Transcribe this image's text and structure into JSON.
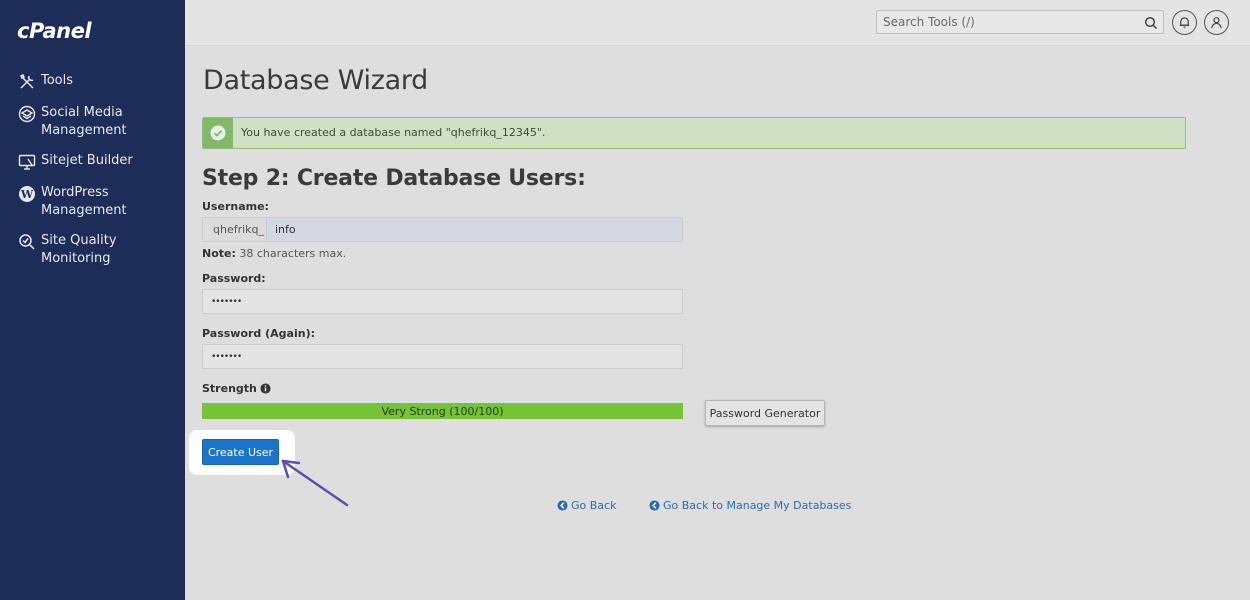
{
  "sidebar": {
    "logo": "cPanel",
    "items": [
      {
        "label_line1": "Tools",
        "label_line2": "",
        "icon": "tools-icon"
      },
      {
        "label_line1": "Social Media",
        "label_line2": "Management",
        "icon": "social-media-icon"
      },
      {
        "label_line1": "Sitejet Builder",
        "label_line2": "",
        "icon": "sitejet-icon"
      },
      {
        "label_line1": "WordPress",
        "label_line2": "Management",
        "icon": "wordpress-icon"
      },
      {
        "label_line1": "Site Quality",
        "label_line2": "Monitoring",
        "icon": "site-quality-icon"
      }
    ]
  },
  "header": {
    "search_placeholder": "Search Tools (/)"
  },
  "main": {
    "title": "Database Wizard",
    "alert": "You have created a database named \"qhefrikq_12345\".",
    "step_title": "Step 2: Create Database Users:",
    "username": {
      "label": "Username:",
      "prefix": "qhefrikq_",
      "value": "info"
    },
    "note": {
      "bold": "Note:",
      "text": " 38 characters max."
    },
    "password": {
      "label": "Password:",
      "value": "•••••••"
    },
    "password_again": {
      "label": "Password (Again):",
      "value": "•••••••"
    },
    "strength": {
      "label": "Strength",
      "text": "Very Strong (100/100)",
      "fraction": 1.0
    },
    "password_generator_label": "Password Generator",
    "create_user_label": "Create User",
    "go_back_label": "Go Back",
    "go_back_manage_label": "Go Back to Manage My Databases"
  },
  "colors": {
    "sidebar_bg": "#1e2d57",
    "accent_blue": "#1b74c9",
    "success_green": "#74c43a",
    "arrow": "#5a4fb0"
  }
}
